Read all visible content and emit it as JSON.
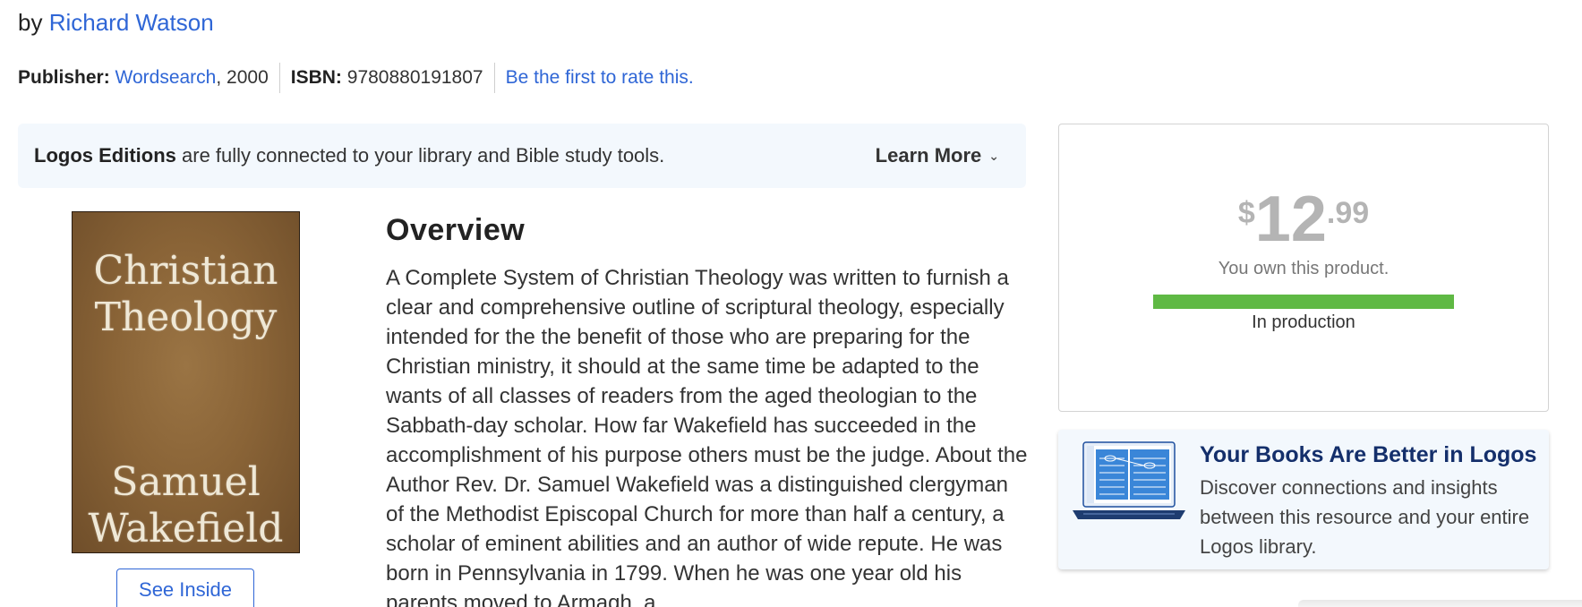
{
  "byline": {
    "prefix": "by",
    "author": "Richard Watson"
  },
  "meta": {
    "publisher_label": "Publisher:",
    "publisher": "Wordsearch",
    "year": ", 2000",
    "isbn_label": "ISBN:",
    "isbn": "9780880191807",
    "rate_link": "Be the first to rate this."
  },
  "editions": {
    "strong": "Logos Editions",
    "text": " are fully connected to your library and Bible study tools.",
    "learn_more": "Learn More"
  },
  "cover": {
    "line1": "Christian",
    "line2": "Theology",
    "line3": "Samuel",
    "line4": "Wakefield"
  },
  "see_inside": "See Inside",
  "overview": {
    "title": "Overview",
    "text": "A Complete System of Christian Theology was written to furnish a clear and comprehensive outline of scriptural theology, especially intended for the the benefit of those who are preparing for the Christian ministry, it should at the same time be adapted to the wants of all classes of readers from the aged theologian to the Sabbath-day scholar. How far Wakefield has succeeded in the accomplishment of his purpose others must be the judge. About the Author Rev. Dr. Samuel Wakefield was a distinguished clergyman of the Methodist Episcopal Church for more than half a century, a scholar of eminent abilities and an author of wide repute. He was born in Pennsylvania in 1799. When he was one year old his parents moved to Armagh, a"
  },
  "price": {
    "currency": "$",
    "whole": "12",
    "cents": ".99",
    "owned_text": "You own this product.",
    "progress_fraction": 1.0,
    "status": "In production",
    "colors": {
      "progress": "#5fb944",
      "price": "#b4b4b4"
    }
  },
  "promo": {
    "title": "Your Books Are Better in Logos",
    "text": "Discover connections and insights between this resource and your entire Logos library.",
    "icon": "laptop-icon"
  }
}
